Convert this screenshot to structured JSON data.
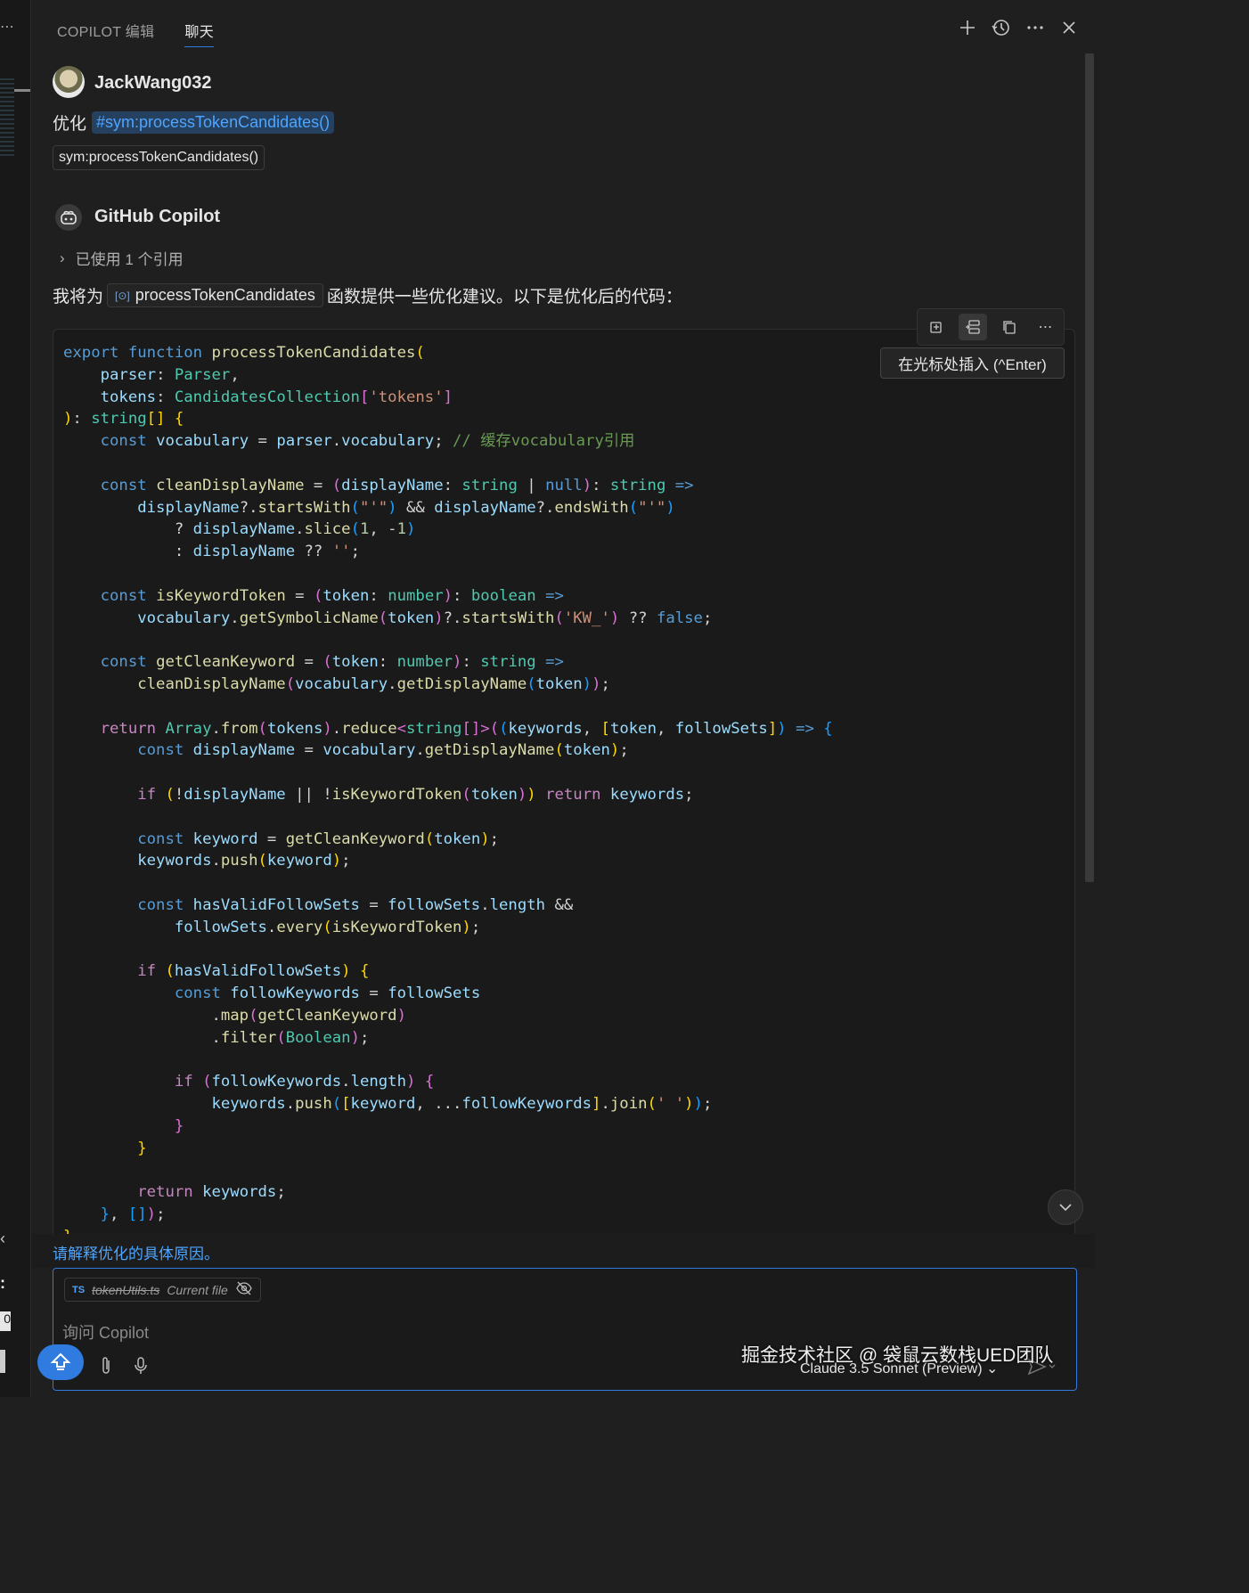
{
  "header": {
    "tabs": [
      {
        "label": "COPILOT 编辑",
        "active": false
      },
      {
        "label": "聊天",
        "active": true
      }
    ],
    "actions": [
      "new-chat-icon",
      "history-icon",
      "more-icon",
      "close-icon"
    ]
  },
  "user_message": {
    "username": "JackWang032",
    "prefix": "优化",
    "symbol_chip": "#sym:processTokenCandidates()",
    "reference": "sym:processTokenCandidates()"
  },
  "response": {
    "author": "GitHub Copilot",
    "references_used": "已使用 1 个引用",
    "intro_before": "我将为",
    "symbol": "processTokenCandidates",
    "intro_after": "函数提供一些优化建议。以下是优化后的代码："
  },
  "code_toolbar": {
    "buttons": [
      "apply-in-editor-icon",
      "insert-at-cursor-icon",
      "copy-icon",
      "more-icon"
    ],
    "tooltip": "在光标处插入 (^Enter)"
  },
  "code": {
    "language": "typescript",
    "comment_text": "// 缓存vocabulary引用"
  },
  "suggestion": "请解释优化的具体原因。",
  "input": {
    "file_type": "TS",
    "file_name": "tokenUtils.ts",
    "file_note": "Current file",
    "placeholder": "询问 Copilot",
    "model": "Claude 3.5 Sonnet (Preview)"
  },
  "watermark": "掘金技术社区 @ 袋鼠云数栈UED团队",
  "colors": {
    "background": "#1f1f1f",
    "accent": "#2f7be0",
    "link": "#4ea5ff"
  }
}
